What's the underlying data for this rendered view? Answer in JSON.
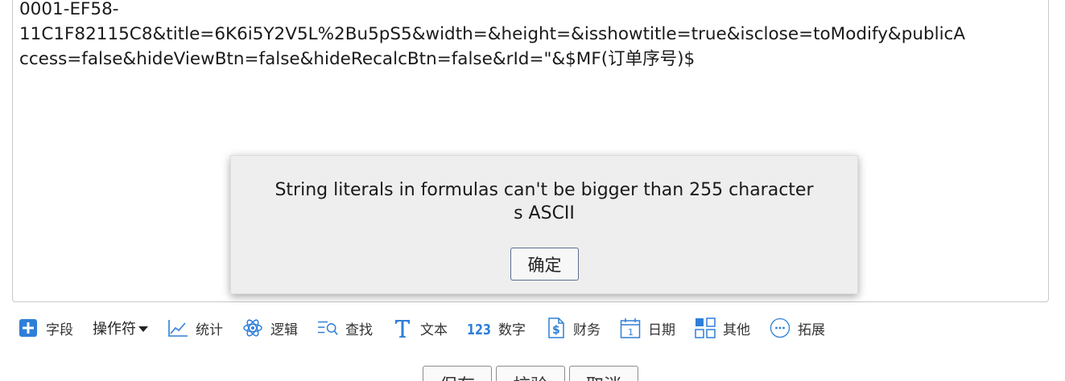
{
  "editor": {
    "line1": "0001-EF58-",
    "line2": "11C1F82115C8&title=6K6i5Y2V5L%2Bu5pS5&width=&height=&isshowtitle=true&isclose=toModify&publicA",
    "line3": "ccess=false&hideViewBtn=false&hideRecalcBtn=false&rId=\"&$MF(订单序号)$"
  },
  "dialog": {
    "message_line1": "String literals in formulas can't be bigger than 255 character",
    "message_line2": "s ASCII",
    "ok_label": "确定"
  },
  "toolbar": {
    "items": [
      {
        "label": "字段",
        "icon": "plus-square-icon"
      },
      {
        "label": "操作符",
        "icon": "caret-down-icon"
      },
      {
        "label": "统计",
        "icon": "line-chart-icon"
      },
      {
        "label": "逻辑",
        "icon": "atom-icon"
      },
      {
        "label": "查找",
        "icon": "list-search-icon"
      },
      {
        "label": "文本",
        "icon": "text-t-icon"
      },
      {
        "label": "数字",
        "icon": "number-123-icon"
      },
      {
        "label": "财务",
        "icon": "dollar-doc-icon"
      },
      {
        "label": "日期",
        "icon": "calendar-icon"
      },
      {
        "label": "其他",
        "icon": "grid-icon"
      },
      {
        "label": "拓展",
        "icon": "ellipsis-circle-icon"
      }
    ]
  },
  "bottom_buttons": {
    "save": "保存",
    "validate": "校验",
    "cancel": "取消"
  },
  "colors": {
    "accent": "#2f7fd8",
    "dialog_bg": "#eeeeee"
  }
}
